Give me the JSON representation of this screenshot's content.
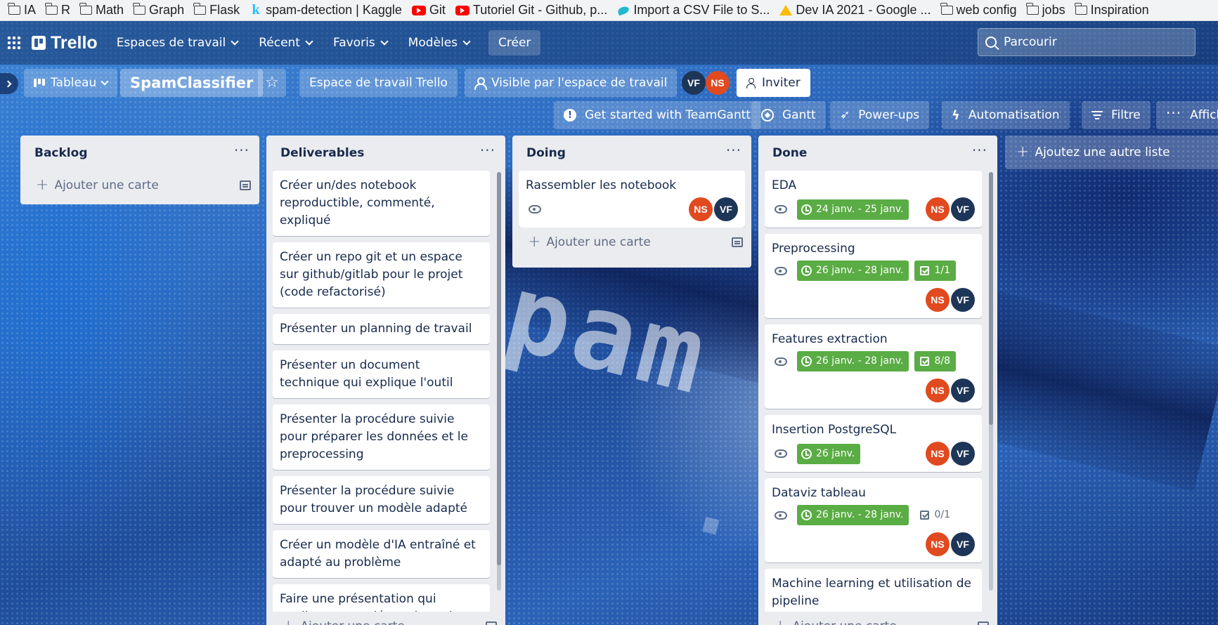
{
  "bookmarks": [
    {
      "label": "IA",
      "icon": "folder-icon"
    },
    {
      "label": "R",
      "icon": "folder-icon"
    },
    {
      "label": "Math",
      "icon": "folder-icon"
    },
    {
      "label": "Graph",
      "icon": "folder-icon"
    },
    {
      "label": "Flask",
      "icon": "folder-icon"
    },
    {
      "label": "spam-detection | Kaggle",
      "icon": "kaggle-icon"
    },
    {
      "label": "Git",
      "icon": "youtube-icon"
    },
    {
      "label": "Tutoriel Git - Github, p...",
      "icon": "youtube-icon"
    },
    {
      "label": "Import a CSV File to S...",
      "icon": "site-icon"
    },
    {
      "label": "Dev IA 2021 - Google ...",
      "icon": "google-drive-icon"
    },
    {
      "label": "web config",
      "icon": "folder-icon"
    },
    {
      "label": "jobs",
      "icon": "folder-icon"
    },
    {
      "label": "Inspiration",
      "icon": "folder-icon"
    }
  ],
  "header": {
    "logo": "Trello",
    "nav": [
      "Espaces de travail",
      "Récent",
      "Favoris",
      "Modèles"
    ],
    "create": "Créer",
    "search_placeholder": "Parcourir"
  },
  "board": {
    "view": "Tableau",
    "title": "SpamClassifier",
    "workspace": "Espace de travail Trello",
    "visibility": "Visible par l'espace de travail",
    "members": [
      "VF",
      "NS"
    ],
    "invite": "Inviter"
  },
  "tools": {
    "teamgantt": "Get started with TeamGantt",
    "gantt": "Gantt",
    "powerups": "Power-ups",
    "automation": "Automatisation",
    "filter": "Filtre",
    "view_more": "Affich"
  },
  "colors": {
    "date_green": "#5aac44",
    "avatar_ns": "#e1491f",
    "avatar_vf": "#1d3557",
    "list_bg": "#ebecf0"
  },
  "lists": {
    "backlog": {
      "title": "Backlog",
      "add_card": "Ajouter une carte"
    },
    "deliverables": {
      "title": "Deliverables",
      "cards": [
        "Créer un/des notebook reproductible, commenté, expliqué",
        "Créer un repo git et un espace sur github/gitlab pour le projet (code refactorisé)",
        "Présenter un planning de travail",
        "Présenter un document technique qui explique l'outil",
        "Présenter la procédure suivie pour préparer les données et le preprocessing",
        "Présenter la procédure suivie pour trouver un modèle adapté",
        "Créer un modèle d'IA entraîné et adapté au problème",
        "Faire une présentation qui explique votre démarche et les résultats obtenus"
      ],
      "add_card": "Ajouter une carte"
    },
    "doing": {
      "title": "Doing",
      "cards": [
        {
          "title": "Rassembler les notebook",
          "members": [
            "NS",
            "VF"
          ]
        }
      ],
      "add_card": "Ajouter une carte"
    },
    "done": {
      "title": "Done",
      "cards": [
        {
          "title": "EDA",
          "date": "24 janv. - 25 janv.",
          "checklist": "",
          "members": [
            "NS",
            "VF"
          ]
        },
        {
          "title": "Preprocessing",
          "date": "26 janv. - 28 janv.",
          "checklist": "1/1",
          "members": [
            "NS",
            "VF"
          ]
        },
        {
          "title": "Features extraction",
          "date": "26 janv. - 28 janv.",
          "checklist": "8/8",
          "members": [
            "NS",
            "VF"
          ]
        },
        {
          "title": "Insertion PostgreSQL",
          "date": "26 janv.",
          "checklist": "",
          "members": [
            "NS",
            "VF"
          ]
        },
        {
          "title": "Dataviz tableau",
          "date": "26 janv. - 28 janv.",
          "checklist": "0/1",
          "members": [
            "NS",
            "VF"
          ]
        },
        {
          "title": "Machine learning et utilisation de pipeline"
        }
      ],
      "add_card": "Ajouter une carte"
    },
    "add_list": "Ajoutez une autre liste"
  }
}
